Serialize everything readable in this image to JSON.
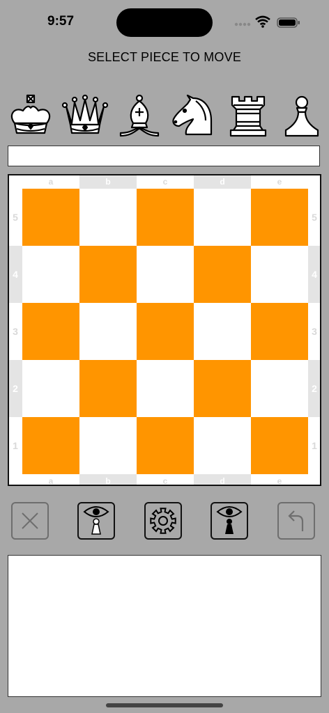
{
  "status_bar": {
    "time": "9:57"
  },
  "header": {
    "title": "SELECT PIECE TO MOVE"
  },
  "piece_selector": {
    "pieces": [
      "king",
      "queen",
      "bishop",
      "knight",
      "rook",
      "pawn"
    ]
  },
  "move_field": {
    "value": ""
  },
  "board": {
    "files": [
      "a",
      "b",
      "c",
      "d",
      "e"
    ],
    "ranks": [
      "5",
      "4",
      "3",
      "2",
      "1"
    ],
    "dark_square_color": "#ff9500",
    "light_square_color": "#ffffff",
    "label_color": "#d9d9d9"
  },
  "controls": {
    "buttons": [
      "close-icon",
      "view-white-icon",
      "settings-icon",
      "view-black-icon",
      "undo-icon"
    ]
  },
  "log": {
    "text": ""
  }
}
